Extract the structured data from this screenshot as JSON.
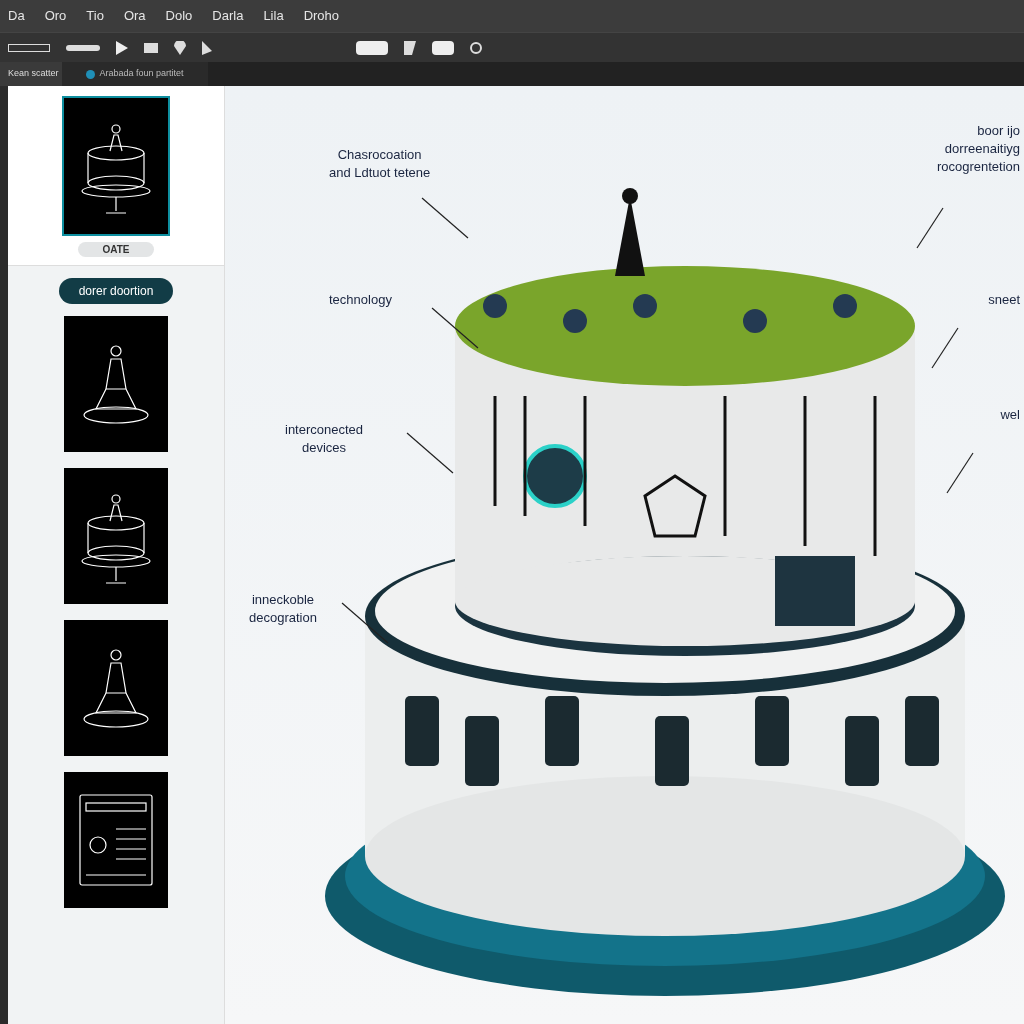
{
  "menu": [
    "Da",
    "Oro",
    "Tio",
    "Ora",
    "Dolo",
    "Darla",
    "Lila",
    "Droho"
  ],
  "tabs": [
    {
      "label": "Kean scatter",
      "selected": true
    },
    {
      "label": "Arabada foun partitet",
      "selected": false
    }
  ],
  "sidebar": {
    "top_item": {
      "kind": "cake",
      "selected": true
    },
    "top_badge": "OATE",
    "action_button": "dorer doortion",
    "items": [
      {
        "kind": "figure",
        "selected": false
      },
      {
        "kind": "cake",
        "selected": false
      },
      {
        "kind": "figure",
        "selected": false
      },
      {
        "kind": "screen",
        "selected": false
      }
    ]
  },
  "annotations": [
    {
      "lines": [
        "Chasrocoation",
        "and Ldtuot tetene"
      ],
      "kind": "left"
    },
    {
      "lines": [
        "technology"
      ],
      "kind": "left"
    },
    {
      "lines": [
        "interconected",
        "devices"
      ],
      "kind": "left"
    },
    {
      "lines": [
        "inneckoble",
        "decogration"
      ],
      "kind": "left"
    },
    {
      "lines": [
        "boor ijo",
        "dorreenaitiyg",
        "rocogrentetion"
      ],
      "kind": "right"
    },
    {
      "lines": [
        "sneet"
      ],
      "kind": "right"
    },
    {
      "lines": [
        "wel"
      ],
      "kind": "right"
    }
  ]
}
